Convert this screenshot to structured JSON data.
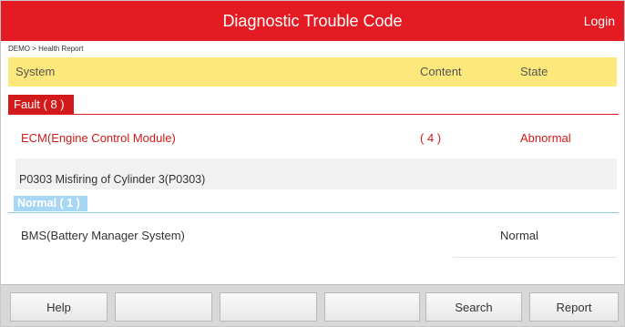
{
  "app": {
    "title": "Diagnostic Trouble Code",
    "login_label": "Login"
  },
  "breadcrumb": "DEMO > Health Report",
  "table_header": {
    "system": "System",
    "content": "Content",
    "state": "State"
  },
  "fault_section": {
    "label": "Fault ( 8 )",
    "row": {
      "name": "ECM(Engine Control Module)",
      "count": "( 4 )",
      "state": "Abnormal"
    },
    "dtc": "P0303 Misfiring of Cylinder 3(P0303)"
  },
  "normal_section": {
    "label": "Normal ( 1 )",
    "row": {
      "name": "BMS(Battery Manager System)",
      "state": "Normal"
    }
  },
  "toolbar": {
    "help_label": "Help",
    "blank_1": "",
    "blank_2": "",
    "blank_3": "",
    "search_label": "Search",
    "report_label": "Report"
  },
  "colors": {
    "accent": "#e41b23",
    "header_bg": "#fde97b",
    "normal_tag": "#a8d7f6"
  }
}
